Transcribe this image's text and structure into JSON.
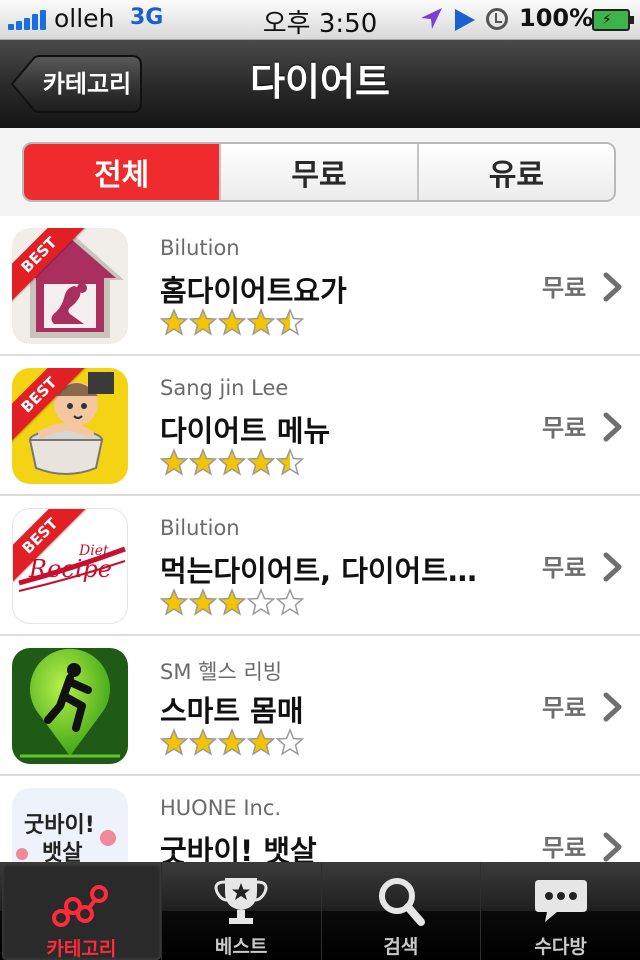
{
  "status_bar": {
    "carrier": "olleh",
    "network": "3G",
    "time": "오후 3:50",
    "battery": "100%",
    "icons": [
      "signal-icon",
      "location-arrow-icon",
      "play-icon",
      "clock-icon",
      "battery-icon"
    ]
  },
  "nav": {
    "back_label": "카테고리",
    "title": "다이어트"
  },
  "segments": [
    {
      "label": "전체",
      "active": true
    },
    {
      "label": "무료",
      "active": false
    },
    {
      "label": "유료",
      "active": false
    }
  ],
  "apps": [
    {
      "developer": "Bilution",
      "name": "홈다이어트요가",
      "price": "무료",
      "rating": 4.5,
      "best": true,
      "badge_text": "BEST",
      "icon": "yoga-house-icon"
    },
    {
      "developer": "Sang jin Lee",
      "name": "다이어트 메뉴",
      "price": "무료",
      "rating": 4.5,
      "best": true,
      "badge_text": "BEST",
      "icon": "cook-pot-icon"
    },
    {
      "developer": "Bilution",
      "name": "먹는다이어트, 다이어트…",
      "price": "무료",
      "rating": 3,
      "best": true,
      "badge_text": "BEST",
      "icon": "diet-recipe-icon",
      "icon_text": [
        "Diet",
        "Recipe"
      ]
    },
    {
      "developer": "SM 헬스 리빙",
      "name": "스마트 몸매",
      "price": "무료",
      "rating": 4,
      "best": false,
      "icon": "runner-pin-icon"
    },
    {
      "developer": "HUONE Inc.",
      "name": "굿바이! 뱃살",
      "price": "무료",
      "rating": null,
      "best": false,
      "icon": "goodbye-belly-icon",
      "icon_text": [
        "굿바이!",
        "뱃살"
      ]
    }
  ],
  "tabs": [
    {
      "label": "카테고리",
      "icon": "category-nodes-icon",
      "active": true
    },
    {
      "label": "베스트",
      "icon": "trophy-star-icon",
      "active": false
    },
    {
      "label": "검색",
      "icon": "search-icon",
      "active": false
    },
    {
      "label": "수다방",
      "icon": "chat-bubble-icon",
      "active": false
    }
  ],
  "colors": {
    "accent_red": "#ef2b2e",
    "star_gold": "#f5c400",
    "navbar_dark": "#1a1a1a"
  }
}
